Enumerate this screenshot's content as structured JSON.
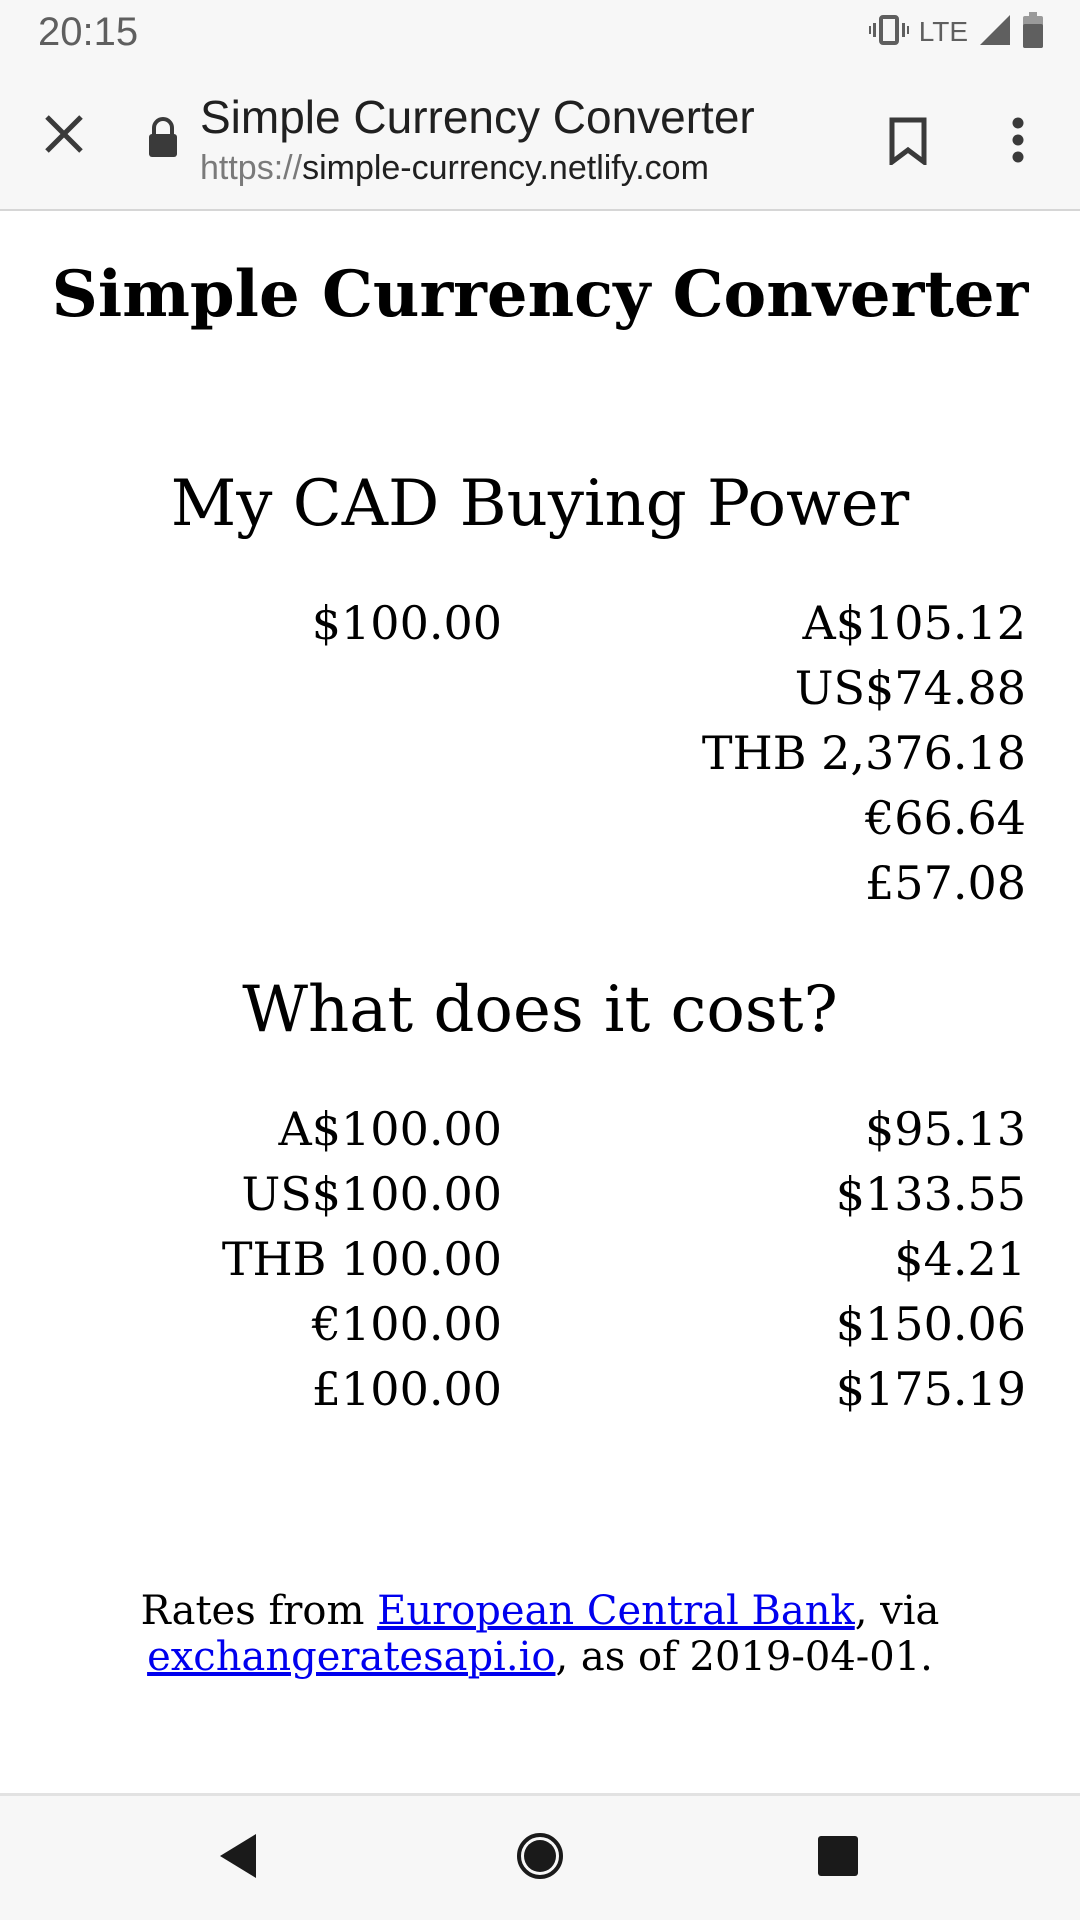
{
  "status_bar": {
    "time": "20:15",
    "network": "LTE",
    "icons": [
      "vibrate-icon",
      "signal-icon",
      "battery-icon"
    ]
  },
  "toolbar": {
    "title": "Simple Currency Converter",
    "url_scheme": "https://",
    "url_host": "simple-currency.netlify.com",
    "icons": [
      "close-icon",
      "lock-icon",
      "bookmark-icon",
      "more-vert-icon"
    ]
  },
  "page": {
    "title": "Simple Currency Converter",
    "buying_power": {
      "heading": "My CAD Buying Power",
      "rows": [
        {
          "from": "$100.00",
          "to": "A$105.12"
        },
        {
          "from": "",
          "to": "US$74.88"
        },
        {
          "from": "",
          "to": "THB 2,376.18"
        },
        {
          "from": "",
          "to": "€66.64"
        },
        {
          "from": "",
          "to": "£57.08"
        }
      ]
    },
    "cost": {
      "heading": "What does it cost?",
      "rows": [
        {
          "from": "A$100.00",
          "to": "$95.13"
        },
        {
          "from": "US$100.00",
          "to": "$133.55"
        },
        {
          "from": "THB 100.00",
          "to": "$4.21"
        },
        {
          "from": "€100.00",
          "to": "$150.06"
        },
        {
          "from": "£100.00",
          "to": "$175.19"
        }
      ]
    },
    "footer": {
      "prefix": "Rates from ",
      "link1": "European Central Bank",
      "middle": ", via",
      "link2": "exchangeratesapi.io",
      "suffix": ", as of 2019-04-01."
    }
  },
  "nav_bar": {
    "icons": [
      "back-icon",
      "home-icon",
      "recents-icon"
    ]
  },
  "colors": {
    "link": "#0000ee",
    "chrome_bg": "#f7f7f7",
    "chrome_text": "#202020"
  }
}
